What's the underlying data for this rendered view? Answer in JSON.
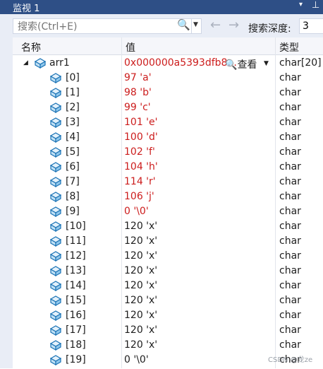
{
  "window": {
    "title": "监视 1",
    "dropdown_glyph": "▾",
    "pin_glyph": "⊥"
  },
  "toolbar": {
    "search_placeholder": "搜索(Ctrl+E)",
    "search_icon": "🔍",
    "back_icon": "←",
    "forward_icon": "→",
    "depth_label": "搜索深度:",
    "depth_value": "3"
  },
  "columns": {
    "name": "名称",
    "value": "值",
    "type": "类型"
  },
  "root": {
    "name": "arr1",
    "value": "0x000000a5393dfb8...",
    "view_label": "查看",
    "type": "char[20]"
  },
  "rows": [
    {
      "name": "[0]",
      "value": "97 'a'",
      "type": "char",
      "changed": true
    },
    {
      "name": "[1]",
      "value": "98 'b'",
      "type": "char",
      "changed": true
    },
    {
      "name": "[2]",
      "value": "99 'c'",
      "type": "char",
      "changed": true
    },
    {
      "name": "[3]",
      "value": "101 'e'",
      "type": "char",
      "changed": true
    },
    {
      "name": "[4]",
      "value": "100 'd'",
      "type": "char",
      "changed": true
    },
    {
      "name": "[5]",
      "value": "102 'f'",
      "type": "char",
      "changed": true
    },
    {
      "name": "[6]",
      "value": "104 'h'",
      "type": "char",
      "changed": true
    },
    {
      "name": "[7]",
      "value": "114 'r'",
      "type": "char",
      "changed": true
    },
    {
      "name": "[8]",
      "value": "106 'j'",
      "type": "char",
      "changed": true
    },
    {
      "name": "[9]",
      "value": "0 '\\0'",
      "type": "char",
      "changed": true
    },
    {
      "name": "[10]",
      "value": "120 'x'",
      "type": "char",
      "changed": false
    },
    {
      "name": "[11]",
      "value": "120 'x'",
      "type": "char",
      "changed": false
    },
    {
      "name": "[12]",
      "value": "120 'x'",
      "type": "char",
      "changed": false
    },
    {
      "name": "[13]",
      "value": "120 'x'",
      "type": "char",
      "changed": false
    },
    {
      "name": "[14]",
      "value": "120 'x'",
      "type": "char",
      "changed": false
    },
    {
      "name": "[15]",
      "value": "120 'x'",
      "type": "char",
      "changed": false
    },
    {
      "name": "[16]",
      "value": "120 'x'",
      "type": "char",
      "changed": false
    },
    {
      "name": "[17]",
      "value": "120 'x'",
      "type": "char",
      "changed": false
    },
    {
      "name": "[18]",
      "value": "120 'x'",
      "type": "char",
      "changed": false
    },
    {
      "name": "[19]",
      "value": "0 '\\0'",
      "type": "char",
      "changed": false
    }
  ],
  "watermark": "CSDN @龙ze",
  "colors": {
    "changed_value": "#cc1c1c",
    "title_bar": "#2e4f86"
  }
}
